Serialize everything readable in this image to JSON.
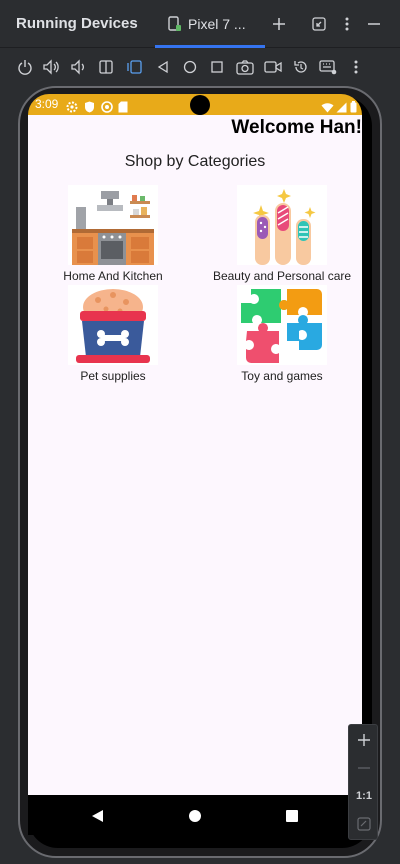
{
  "window": {
    "title": "Running Devices",
    "tab_label": "Pixel 7 ..."
  },
  "status_bar": {
    "time": "3:09"
  },
  "app": {
    "welcome_text": "Welcome Han!",
    "section_title": "Shop by Categories",
    "categories": [
      {
        "label": "Home And Kitchen",
        "icon": "kitchen-illustration"
      },
      {
        "label": "Beauty and Personal care",
        "icon": "nails-illustration"
      },
      {
        "label": "Pet supplies",
        "icon": "pet-food-bowl-illustration"
      },
      {
        "label": "Toy and games",
        "icon": "puzzle-illustration"
      }
    ]
  },
  "emulator_panel": {
    "zoom_label": "1:1"
  },
  "colors": {
    "status_bar": "#e8aa19",
    "screen_background": "#fdf7fe",
    "tab_underline": "#3574f0",
    "ide_background": "#2b2d30"
  }
}
